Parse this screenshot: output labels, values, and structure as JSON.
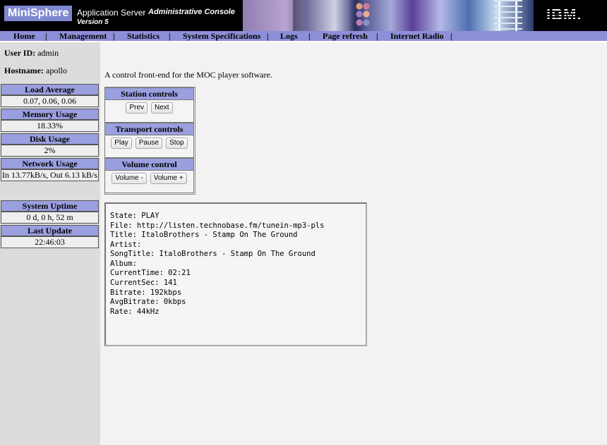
{
  "banner": {
    "brand": "MiniSphere",
    "product": "Application Server",
    "version": "Version 5",
    "console": "Administrative Console",
    "vendor_logo": "IBM."
  },
  "nav": {
    "items": [
      {
        "label": "Home"
      },
      {
        "label": "Management"
      },
      {
        "label": "Statistics"
      },
      {
        "label": "System Specifications"
      },
      {
        "label": "Logs"
      },
      {
        "label": "Page refresh"
      },
      {
        "label": "Internet Radio"
      }
    ],
    "separator": "|"
  },
  "sidebar": {
    "user_id_label": "User ID:",
    "user_id": "admin",
    "hostname_label": "Hostname:",
    "hostname": "apollo",
    "stats": [
      {
        "title": "Load Average",
        "value": "0.07, 0.06, 0.06"
      },
      {
        "title": "Memory Usage",
        "value": "18.33%"
      },
      {
        "title": "Disk Usage",
        "value": "2%"
      },
      {
        "title": "Network Usage",
        "value": "In 13.77kB/s, Out 6.13 kB/s"
      },
      {
        "title": "System Uptime",
        "value": "0 d, 0 h, 52 m"
      },
      {
        "title": "Last Update",
        "value": "22:46:03"
      }
    ]
  },
  "main": {
    "intro": "A control front-end for the MOC player software.",
    "station": {
      "title": "Station controls",
      "prev": "Prev",
      "next": "Next"
    },
    "transport": {
      "title": "Transport controls",
      "play": "Play",
      "pause": "Pause",
      "stop": "Stop"
    },
    "volume": {
      "title": "Volume control",
      "down": "Volume -",
      "up": "Volume +"
    },
    "status_lines": [
      "State: PLAY",
      "File: http://listen.technobase.fm/tunein-mp3-pls",
      "Title: ItaloBrothers - Stamp On The Ground",
      "Artist:",
      "SongTitle: ItaloBrothers - Stamp On The Ground",
      "Album:",
      "CurrentTime: 02:21",
      "CurrentSec: 141",
      "Bitrate: 192kbps",
      "AvgBitrate: 0kbps",
      "Rate: 44kHz"
    ]
  }
}
